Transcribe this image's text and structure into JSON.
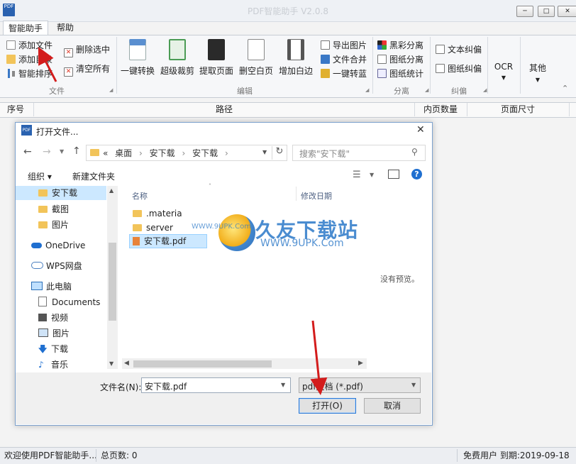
{
  "window": {
    "title": "PDF智能助手 V2.0.8",
    "logo_text": "PDF",
    "controls": [
      "minimize",
      "maximize",
      "close"
    ]
  },
  "tabs": [
    {
      "label": "智能助手",
      "active": true
    },
    {
      "label": "帮助",
      "active": false
    }
  ],
  "ribbon": {
    "file_group": {
      "label": "文件",
      "items": [
        {
          "label": "添加文件",
          "icon": "add-file-icon"
        },
        {
          "label": "添加目录",
          "icon": "add-folder-icon"
        },
        {
          "label": "智能排序",
          "icon": "sort-icon"
        },
        {
          "label": "删除选中",
          "icon": "delete-selected-icon"
        },
        {
          "label": "清空所有",
          "icon": "clear-all-icon"
        }
      ]
    },
    "edit_group": {
      "label": "编辑",
      "items": [
        {
          "label": "一键转换",
          "icon": "convert-icon"
        },
        {
          "label": "超级裁剪",
          "icon": "crop-icon"
        },
        {
          "label": "提取页面",
          "icon": "extract-pages-icon"
        },
        {
          "label": "删空白页",
          "icon": "delete-blank-pages-icon"
        },
        {
          "label": "增加白边",
          "icon": "add-margin-icon"
        }
      ],
      "small_items": [
        {
          "label": "导出图片",
          "icon": "export-image-icon"
        },
        {
          "label": "文件合并",
          "icon": "merge-icon"
        },
        {
          "label": "一键转蓝",
          "icon": "to-blue-icon"
        }
      ]
    },
    "separate_group": {
      "label": "分离",
      "items": [
        {
          "label": "黑彩分离",
          "icon": "color-separate-icon"
        },
        {
          "label": "图纸分离",
          "icon": "drawing-separate-icon"
        },
        {
          "label": "图纸统计",
          "icon": "drawing-stats-icon"
        }
      ]
    },
    "correct_group": {
      "label": "纠偏",
      "items": [
        {
          "label": "文本纠偏",
          "icon": "text-deskew-icon"
        },
        {
          "label": "图纸纠偏",
          "icon": "drawing-deskew-icon"
        }
      ]
    },
    "ocr_label": "OCR",
    "other_label": "其他"
  },
  "file_table": {
    "columns": [
      "序号",
      "路径",
      "内页数量",
      "页面尺寸"
    ]
  },
  "dialog": {
    "title": "打开文件...",
    "breadcrumb": [
      "«",
      "桌面",
      "安下载",
      "安下载"
    ],
    "search_placeholder": "搜索\"安下载\"",
    "toolbar": {
      "organize": "组织 ▾",
      "new_folder": "新建文件夹"
    },
    "nav_tree": [
      {
        "label": "安下载",
        "icon": "folder-icon",
        "selected": true
      },
      {
        "label": "截图",
        "icon": "folder-icon",
        "selected": false
      },
      {
        "label": "图片",
        "icon": "folder-icon",
        "selected": false
      },
      {
        "label": "OneDrive",
        "icon": "onedrive-icon",
        "selected": false
      },
      {
        "label": "WPS网盘",
        "icon": "cloud-icon",
        "selected": false
      },
      {
        "label": "此电脑",
        "icon": "computer-icon",
        "selected": false
      },
      {
        "label": "Documents",
        "icon": "documents-icon",
        "selected": false
      },
      {
        "label": "视频",
        "icon": "video-icon",
        "selected": false
      },
      {
        "label": "图片",
        "icon": "picture-icon",
        "selected": false
      },
      {
        "label": "下载",
        "icon": "download-icon",
        "selected": false
      },
      {
        "label": "音乐",
        "icon": "music-icon",
        "selected": false
      }
    ],
    "file_columns": {
      "name": "名称",
      "date": "修改日期"
    },
    "files": [
      {
        "name": ".materia",
        "type": "folder",
        "selected": false
      },
      {
        "name": "server",
        "type": "folder",
        "selected": false
      },
      {
        "name": "安下载.pdf",
        "type": "pdf",
        "selected": true
      }
    ],
    "preview_text": "没有预览。",
    "filename_label": "文件名(N):",
    "filename_value": "安下载.pdf",
    "filetype_value": "pdf文档 (*.pdf)",
    "open_button": "打开(O)",
    "cancel_button": "取消"
  },
  "watermark": {
    "main": "久友下载站",
    "url": "WWW.9UPK.Com",
    "small": "WWW.9UPK.Com"
  },
  "status_bar": {
    "welcome": "欢迎使用PDF智能助手...",
    "total_pages": "总页数: 0",
    "user_info": "免费用户 到期:2019-09-18"
  },
  "colors": {
    "accent_blue": "#2d7ad6",
    "annotation_red": "#d31c1c",
    "folder_yellow": "#f2c45a",
    "selection_bg": "#cce8ff"
  }
}
